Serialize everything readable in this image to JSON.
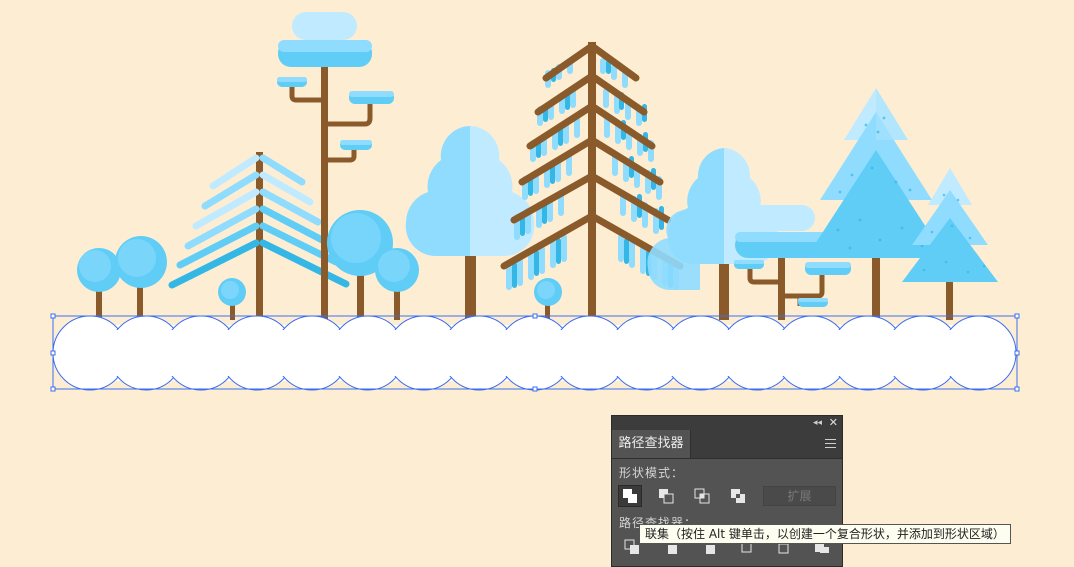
{
  "panel": {
    "title_tab": "路径查找器",
    "shape_modes_label": "形状模式：",
    "pathfinders_label": "路径查找器：",
    "expand_label": "扩展",
    "collapse_glyph": "◂◂",
    "close_glyph": "✕"
  },
  "shape_mode_buttons": [
    {
      "name": "unite-icon",
      "selected": true
    },
    {
      "name": "minus-front-icon",
      "selected": false
    },
    {
      "name": "intersect-icon",
      "selected": false
    },
    {
      "name": "exclude-icon",
      "selected": false
    }
  ],
  "pathfinder_buttons": [
    {
      "name": "divide-icon"
    },
    {
      "name": "trim-icon"
    },
    {
      "name": "merge-icon"
    },
    {
      "name": "crop-icon"
    },
    {
      "name": "outline-icon"
    },
    {
      "name": "minus-back-icon"
    }
  ],
  "tooltip": {
    "text": "联集（按住 Alt 键单击，以创建一个复合形状，并添加到形状区域）"
  },
  "colors": {
    "background": "#fdeed3",
    "trunk": "#8b5a2b",
    "light_blue": "#bfeaff",
    "mid_blue": "#8fdcff",
    "blue": "#5fcdf6",
    "dark_blue": "#35b7e6",
    "selection_blue": "#3a6df0",
    "panel": "#535353"
  }
}
